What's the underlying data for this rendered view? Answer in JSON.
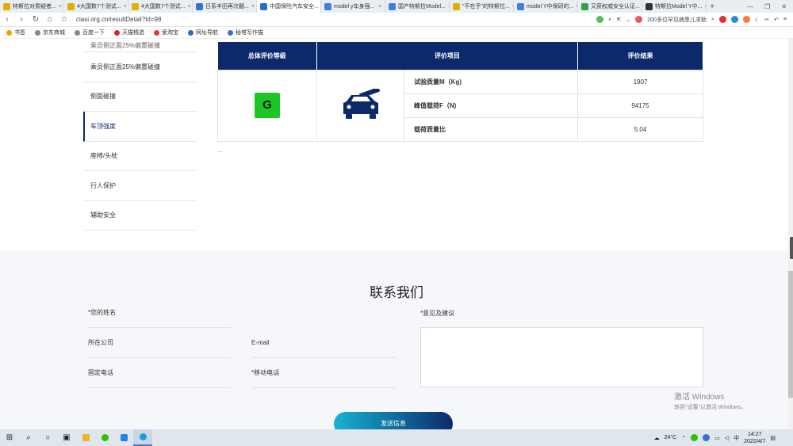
{
  "browser": {
    "tabs": [
      {
        "title": "特斯拉对质疑者...",
        "color": "#e0b000",
        "active": false
      },
      {
        "title": "4大国数7个测试...",
        "color": "#e0b000",
        "active": false
      },
      {
        "title": "4大国数7个测试...",
        "color": "#e0b000",
        "active": false
      },
      {
        "title": "日系丰田再次翻...",
        "color": "#3b6fd1",
        "active": false
      },
      {
        "title": "中国保险汽车安全...",
        "color": "#2a6ad1",
        "active": true
      },
      {
        "title": "model y车身强...",
        "color": "#4a7bd6",
        "active": false
      },
      {
        "title": "国产特斯拉Model...",
        "color": "#4a7bd6",
        "active": false
      },
      {
        "title": "\"不在乎\"的特斯拉...",
        "color": "#e0b000",
        "active": false
      },
      {
        "title": "model Y中保研的...",
        "color": "#4a7bd6",
        "active": false
      },
      {
        "title": "又获权威安全认证...",
        "color": "#3a9d4a",
        "active": false
      },
      {
        "title": "特斯拉Model Y中...",
        "color": "#333333",
        "active": false
      }
    ],
    "url": "ciasi.org.cn/resultDetail?Id=98",
    "search_hint": "200多位罕见病患儿求助",
    "bookmarks": [
      "书签",
      "京东商城",
      "百度一下",
      "天猫精选",
      "爱淘宝",
      "网址导航",
      "秘塔写作猫"
    ]
  },
  "sidebar": {
    "items": [
      {
        "label": "乘员侧正面25%偏置碰撞",
        "state": "partial"
      },
      {
        "label": "乘员侧正面25%偏置碰撞",
        "state": "normal"
      },
      {
        "label": "侧面碰撞",
        "state": "normal"
      },
      {
        "label": "车顶强度",
        "state": "active"
      },
      {
        "label": "座椅/头枕",
        "state": "normal"
      },
      {
        "label": "行人保护",
        "state": "normal"
      },
      {
        "label": "辅助安全",
        "state": "normal"
      }
    ]
  },
  "result_table": {
    "headers": [
      "总体评价等级",
      "评价项目",
      "评价结果"
    ],
    "grade": "G",
    "grade_color": "#1ec526",
    "car_icon": "car-roof-crush-icon",
    "rows": [
      {
        "item": "试验质量M（Kg)",
        "value": "1907"
      },
      {
        "item": "峰值载荷F（N)",
        "value": "94175"
      },
      {
        "item": "载荷质量比",
        "value": "5.04"
      }
    ],
    "header_color": "#0c2a6b"
  },
  "after_table_text": "...",
  "contact": {
    "title": "联系我们",
    "name_label": "*您的姓名",
    "company_label": "所在公司",
    "email_label": "E-mail",
    "phone_label": "固定电话",
    "mobile_label": "*移动电话",
    "feedback_label": "*意见及建议",
    "send_label": "发送信息"
  },
  "watermark": {
    "line1": "激活 Windows",
    "line2": "转到\"设置\"以激活 Windows。"
  },
  "taskbar": {
    "weather": "24°C",
    "time": "14:27",
    "date": "2022/4/7"
  }
}
